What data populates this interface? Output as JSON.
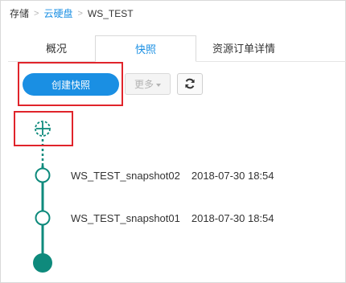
{
  "breadcrumb": {
    "items": [
      "存储",
      "云硬盘",
      "WS_TEST"
    ],
    "separator": ">"
  },
  "tabs": [
    {
      "label": "概况",
      "active": false
    },
    {
      "label": "快照",
      "active": true
    },
    {
      "label": "资源订单详情",
      "active": false
    }
  ],
  "toolbar": {
    "create_label": "创建快照",
    "more_label": "更多",
    "refresh_icon": "refresh-icon"
  },
  "timeline": {
    "add_icon": "add-snapshot-icon",
    "snapshots": [
      {
        "name": "WS_TEST_snapshot02",
        "date": "2018-07-30 18:54"
      },
      {
        "name": "WS_TEST_snapshot01",
        "date": "2018-07-30 18:54"
      }
    ]
  },
  "colors": {
    "accent": "#1a8fe3",
    "timeline": "#0e8a7c",
    "highlight": "#e0242b"
  }
}
